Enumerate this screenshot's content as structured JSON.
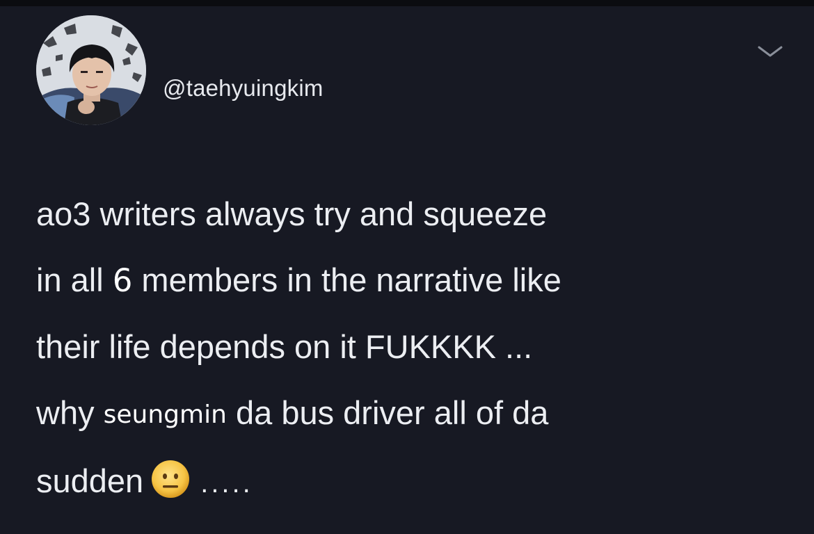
{
  "tweet": {
    "handle": "@taehyuingkim",
    "lines": [
      "ao3 writers always try and squeeze",
      "in all ",
      "6",
      " members in the narrative like",
      "their life depends on it FUKKKK ...",
      "why ",
      "seungmin",
      " da bus driver all of da",
      "sudden",
      "....."
    ],
    "emoji": "neutral-face-emoji"
  },
  "colors": {
    "background": "#171923",
    "text": "#eceef2"
  }
}
